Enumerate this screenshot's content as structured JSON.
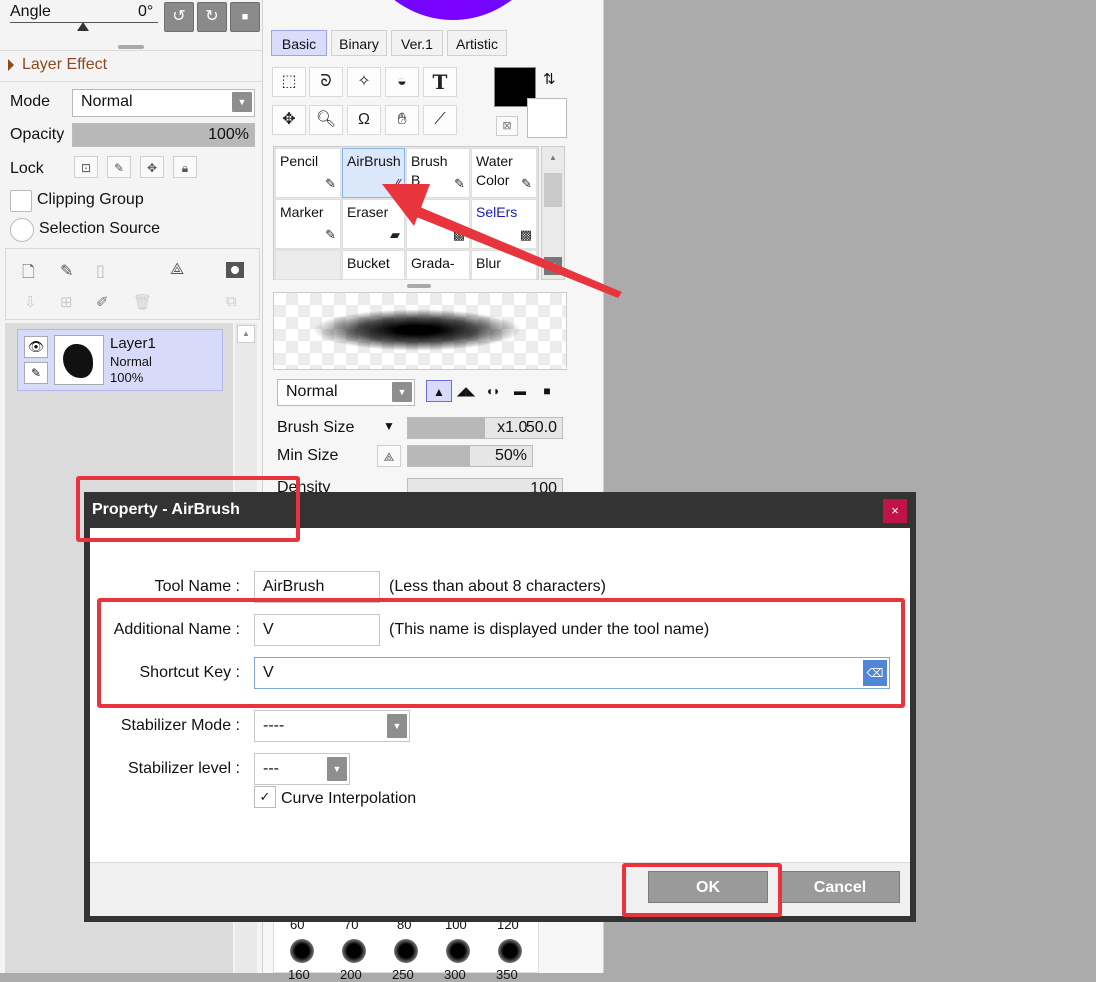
{
  "left_panel": {
    "angle_label": "Angle",
    "angle_value": "0°",
    "rotate_ccw_icon": "↺",
    "rotate_cw_icon": "↻",
    "reset_icon": "■",
    "layer_effect_label": "Layer Effect",
    "mode_label": "Mode",
    "mode_value": "Normal",
    "opacity_label": "Opacity",
    "opacity_value": "100%",
    "opacity_fraction": 1.0,
    "lock_label": "Lock",
    "clipping_group_label": "Clipping Group",
    "selection_source_label": "Selection Source",
    "layer": {
      "name": "Layer1",
      "mode": "Normal",
      "opacity": "100%"
    }
  },
  "mid_panel": {
    "tabs": [
      {
        "label": "Basic",
        "active": true
      },
      {
        "label": "Binary",
        "active": false
      },
      {
        "label": "Ver.1",
        "active": false
      },
      {
        "label": "Artistic",
        "active": false
      }
    ],
    "text_tool_glyph": "T",
    "brushes": [
      {
        "name": "Pencil",
        "sub": "",
        "selected": false
      },
      {
        "name": "AirBrush",
        "sub": "",
        "selected": true
      },
      {
        "name": "Brush",
        "sub": "B",
        "selected": false
      },
      {
        "name": "Water",
        "sub": "Color",
        "selected": false
      },
      {
        "name": "Marker",
        "sub": "",
        "selected": false
      },
      {
        "name": "Eraser",
        "sub": "",
        "selected": false
      },
      {
        "name": "Se",
        "sub": "",
        "selected": false
      },
      {
        "name": "SelErs",
        "sub": "",
        "selected": false
      },
      {
        "name": "",
        "sub": "",
        "selected": false
      },
      {
        "name": "Bucket",
        "sub": "",
        "selected": false
      },
      {
        "name": "Grada-",
        "sub": "",
        "selected": false
      },
      {
        "name": "Blur",
        "sub": "",
        "selected": false
      }
    ],
    "blend_mode": "Normal",
    "brush_size_label": "Brush Size",
    "brush_size_multiplier": "x1.0",
    "brush_size_value": "50.0",
    "brush_size_fraction": 0.5,
    "min_size_label": "Min Size",
    "min_size_value": "50%",
    "min_size_fraction": 0.5,
    "density_label": "Density",
    "density_value": "100",
    "size_presets_row1": [
      "60",
      "70",
      "80",
      "100",
      "120"
    ],
    "size_presets_row2": [
      "160",
      "200",
      "250",
      "300",
      "350"
    ]
  },
  "dialog": {
    "title": "Property - AirBrush",
    "close_glyph": "×",
    "tool_name_label": "Tool Name :",
    "tool_name_value": "AirBrush",
    "tool_name_note": "(Less than about 8 characters)",
    "additional_name_label": "Additional Name :",
    "additional_name_value": "V",
    "additional_name_note": "(This name is displayed under the tool name)",
    "shortcut_key_label": "Shortcut Key :",
    "shortcut_key_value": "V",
    "stabilizer_mode_label": "Stabilizer Mode :",
    "stabilizer_mode_value": "----",
    "stabilizer_level_label": "Stabilizer level :",
    "stabilizer_level_value": "---",
    "curve_interpolation_label": "Curve Interpolation",
    "curve_interpolation_checked": true,
    "ok_label": "OK",
    "cancel_label": "Cancel"
  },
  "colors": {
    "accent_red": "#e8353d",
    "selected_blue": "#d9dcfb",
    "dialog_frame": "#333333",
    "close_button": "#c0134a"
  }
}
